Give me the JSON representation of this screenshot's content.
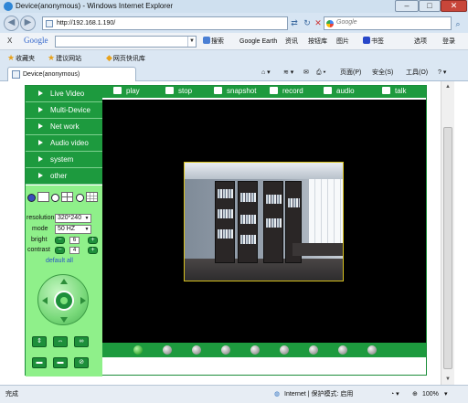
{
  "window": {
    "title": "Device(anonymous) - Windows Internet Explorer",
    "minimize": "–",
    "maximize": "□",
    "close": "✕"
  },
  "address": {
    "url": "http://192.168.1.190/",
    "search_placeholder": "Google"
  },
  "google_toolbar": {
    "logo": "Google",
    "items": [
      "搜索",
      "Google Earth",
      "资讯",
      "按钮库",
      "图片",
      "书签",
      "选项",
      "登录"
    ]
  },
  "favorites": {
    "label": "收藏夹",
    "items": [
      "建议网站",
      "网页快讯库"
    ]
  },
  "tab": {
    "title": "Device(anonymous)"
  },
  "command_bar": {
    "items": [
      "页面(P)",
      "安全(S)",
      "工具(O)"
    ]
  },
  "camera": {
    "menu": [
      "Live Video",
      "Multi-Device",
      "Net work",
      "Audio video",
      "system",
      "other"
    ],
    "toolbar": [
      "play",
      "stop",
      "snapshot",
      "record",
      "audio",
      "talk"
    ],
    "controls": {
      "resolution_label": "resolution",
      "resolution_value": "320*240",
      "mode_label": "mode",
      "mode_value": "50 HZ",
      "bright_label": "bright",
      "bright_value": "6",
      "contrast_label": "contrast",
      "contrast_value": "4",
      "minus": "−",
      "plus": "+",
      "default_link": "default all"
    },
    "channel_count": 9,
    "active_channel": 0
  },
  "status": {
    "left": "完成",
    "zone": "Internet | 保护模式: 启用",
    "zoom": "100%"
  },
  "colors": {
    "accent_green": "#1d9a3e",
    "panel_green": "#8ff08a"
  },
  "icons": [
    "back-icon",
    "forward-icon",
    "refresh-icon",
    "stop-icon",
    "search-icon",
    "star-icon",
    "home-icon",
    "print-icon",
    "help-icon"
  ]
}
